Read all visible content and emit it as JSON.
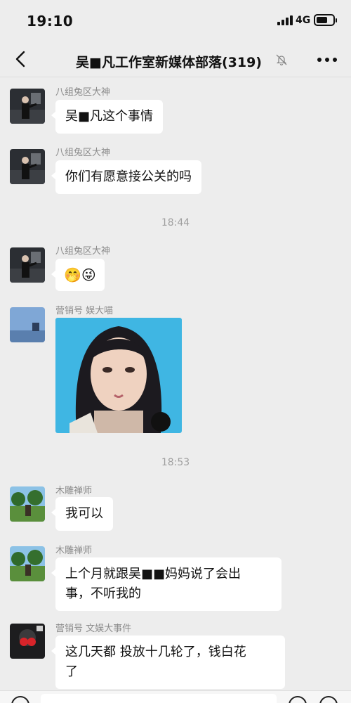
{
  "status_bar": {
    "time": "19:10",
    "network": "4G"
  },
  "header": {
    "title": "吴■凡工作室新媒体部落(319)"
  },
  "messages": [
    {
      "sender": "八组兔区大神",
      "text": "吴■凡这个事情"
    },
    {
      "sender": "八组兔区大神",
      "text": "你们有愿意接公关的吗"
    },
    {
      "sender": "八组兔区大神",
      "text": "🤭😜"
    },
    {
      "sender": "营销号 娱大喵"
    },
    {
      "sender": "木雕禅师",
      "text": "我可以"
    },
    {
      "sender": "木雕禅师",
      "text_line1": "上个月就跟吴■■妈妈说了会出",
      "text_line2": "事，不听我的"
    },
    {
      "sender": "营销号 文娱大事件",
      "text_line1": "这几天都 投放十几轮了，钱白花",
      "text_line2": "了"
    }
  ],
  "time_dividers": [
    "18:44",
    "18:53"
  ],
  "icons": {
    "back": "chevron-left-icon",
    "mute": "bell-slash-icon",
    "more": "more-dots-icon",
    "voice": "voice-icon",
    "emoji": "emoji-icon",
    "plus": "plus-icon"
  },
  "colors": {
    "background": "#ededed",
    "bubble": "#ffffff",
    "meta_text": "#8a8a8a"
  }
}
